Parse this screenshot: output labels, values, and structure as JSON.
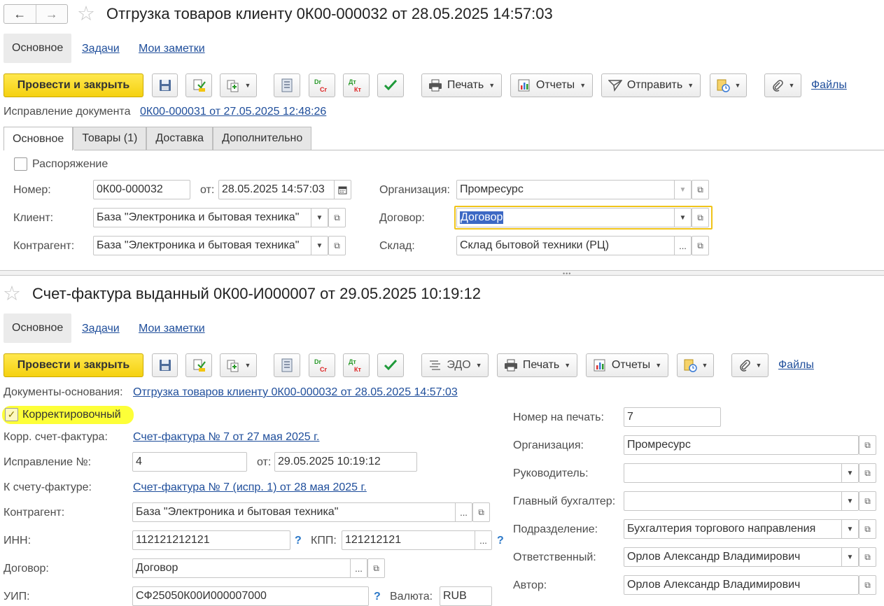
{
  "top": {
    "title": "Отгрузка товаров клиенту 0К00-000032 от 28.05.2025 14:57:03",
    "nav_tabs": [
      "Основное",
      "Задачи",
      "Мои заметки"
    ],
    "post_close": "Провести и закрыть",
    "print": "Печать",
    "reports": "Отчеты",
    "send": "Отправить",
    "files": "Файлы",
    "correction_label": "Исправление документа",
    "correction_link": "0К00-000031 от 27.05.2025 12:48:26",
    "tabs": [
      "Основное",
      "Товары (1)",
      "Доставка",
      "Дополнительно"
    ],
    "disposition_label": "Распоряжение",
    "number_label": "Номер:",
    "number_value": "0К00-000032",
    "from_label": "от:",
    "date_value": "28.05.2025 14:57:03",
    "client_label": "Клиент:",
    "client_value": "База \"Электроника и бытовая техника\"",
    "counterparty_label": "Контрагент:",
    "counterparty_value": "База \"Электроника и бытовая техника\"",
    "org_label": "Организация:",
    "org_value": "Промресурс",
    "contract_label": "Договор:",
    "contract_value": "Договор",
    "warehouse_label": "Склад:",
    "warehouse_value": "Склад бытовой техники (РЦ)"
  },
  "bottom": {
    "title": "Счет-фактура выданный 0К00-И000007 от 29.05.2025 10:19:12",
    "nav_tabs": [
      "Основное",
      "Задачи",
      "Мои заметки"
    ],
    "post_close": "Провести и закрыть",
    "edo": "ЭДО",
    "print": "Печать",
    "reports": "Отчеты",
    "files": "Файлы",
    "base_docs_label": "Документы-основания:",
    "base_docs_link": "Отгрузка товаров клиенту 0К00-000032 от 28.05.2025 14:57:03",
    "corrective_label": "Корректировочный",
    "corr_invoice_label": "Корр. счет-фактура:",
    "corr_invoice_link": "Счет-фактура № 7 от 27 мая 2025 г.",
    "correction_no_label": "Исправление №:",
    "correction_no_value": "4",
    "from_label": "от:",
    "correction_date_value": "29.05.2025 10:19:12",
    "to_invoice_label": "К счету-фактуре:",
    "to_invoice_link": "Счет-фактура № 7 (испр. 1) от 28 мая 2025 г.",
    "counterparty_label": "Контрагент:",
    "counterparty_value": "База \"Электроника и бытовая техника\"",
    "inn_label": "ИНН:",
    "inn_value": "112121212121",
    "kpp_label": "КПП:",
    "kpp_value": "121212121",
    "contract_label": "Договор:",
    "contract_value": "Договор",
    "uip_label": "УИП:",
    "uip_value": "СФ25050К00И000007000",
    "currency_label": "Валюта:",
    "currency_value": "RUB",
    "print_no_label": "Номер на печать:",
    "print_no_value": "7",
    "org_label": "Организация:",
    "org_value": "Промресурс",
    "head_label": "Руководитель:",
    "head_value": "",
    "chief_acc_label": "Главный бухгалтер:",
    "chief_acc_value": "",
    "dept_label": "Подразделение:",
    "dept_value": "Бухгалтерия торгового направления",
    "resp_label": "Ответственный:",
    "resp_value": "Орлов Александр Владимирович",
    "author_label": "Автор:",
    "author_value": "Орлов Александр Владимирович"
  },
  "colors": {
    "accent_yellow": "#f5d110",
    "link": "#1f4e9b",
    "highlight": "#fdff38",
    "focus_border": "#f0c419"
  }
}
